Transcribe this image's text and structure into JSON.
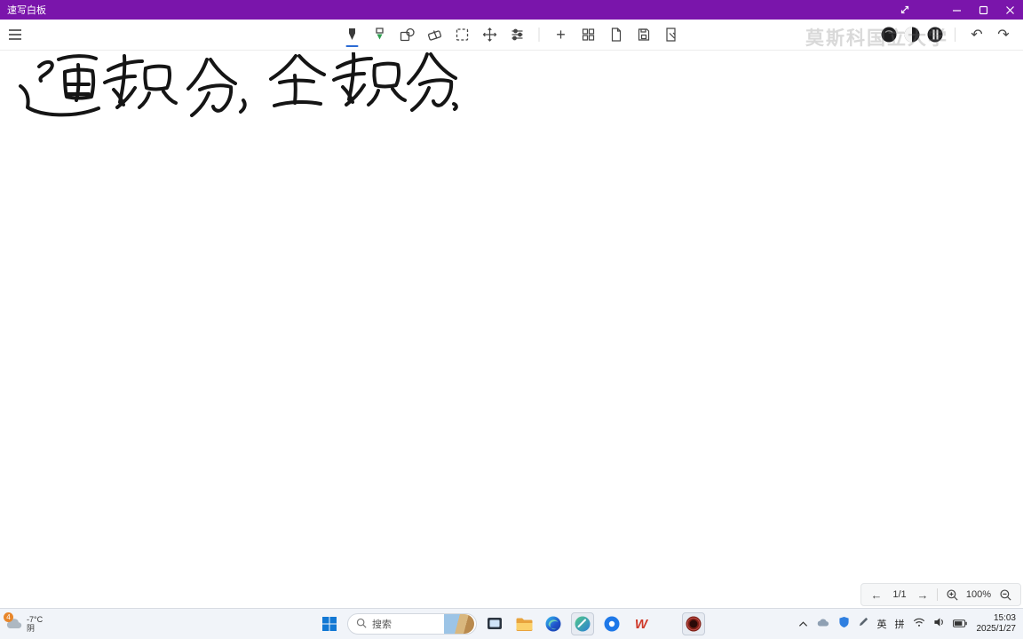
{
  "titlebar": {
    "title": "速写白板",
    "bg": "#7a15ab"
  },
  "toolbar": {
    "watermark": "莫斯科国立大学",
    "add_glyph": "+",
    "undo_glyph": "↶",
    "redo_glyph": "↷",
    "accent": "#2b6bd4",
    "tools": [
      "pen",
      "highlighter",
      "shapes",
      "eraser",
      "lasso-select",
      "pan",
      "ink-settings",
      "add",
      "template-gallery",
      "new-page",
      "save",
      "export"
    ]
  },
  "canvas": {
    "handwriting": "通积分，全积分."
  },
  "pagenav": {
    "back_glyph": "←",
    "forward_glyph": "→",
    "page": "1/1",
    "zoom": "100%"
  },
  "weather": {
    "badge": "4",
    "temp": "-7°C",
    "condition": "阴"
  },
  "taskbar": {
    "search_placeholder": "搜索",
    "wps_glyph": "W"
  },
  "tray": {
    "ime_lang": "英",
    "ime_mode": "拼",
    "time": "15:03",
    "date": "2025/1/27"
  }
}
